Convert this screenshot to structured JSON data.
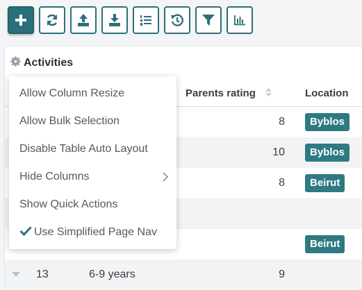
{
  "toolbar": {
    "buttons": [
      {
        "name": "add-button",
        "icon": "plus-icon"
      },
      {
        "name": "refresh-button",
        "icon": "refresh-icon"
      },
      {
        "name": "export-button",
        "icon": "upload-icon"
      },
      {
        "name": "import-button",
        "icon": "download-icon"
      },
      {
        "name": "columns-list-button",
        "icon": "numbered-list-icon"
      },
      {
        "name": "history-button",
        "icon": "history-icon"
      },
      {
        "name": "filter-button",
        "icon": "filter-icon"
      },
      {
        "name": "chart-button",
        "icon": "bar-chart-icon"
      }
    ]
  },
  "panel": {
    "title": "Activities",
    "icon": "gear-icon"
  },
  "table": {
    "columns": [
      "Parents rating",
      "Location"
    ],
    "rows": [
      {
        "rating": "8",
        "location": "Byblos"
      },
      {
        "rating": "10",
        "location": "Byblos"
      },
      {
        "rating": "8",
        "location": "Beirut"
      },
      {
        "rating": "",
        "location": ""
      },
      {
        "rating": "",
        "location": "Beirut"
      },
      {
        "id": "13",
        "age": "6-9 years",
        "rating": "9",
        "location": ""
      }
    ]
  },
  "menu": {
    "items": [
      {
        "label": "Allow Column Resize"
      },
      {
        "label": "Allow Bulk Selection"
      },
      {
        "label": "Disable Table Auto Layout"
      },
      {
        "label": "Hide Columns",
        "submenu": true
      },
      {
        "label": "Show Quick Actions"
      },
      {
        "label": "Use Simplified Page Nav",
        "checked": true
      }
    ]
  },
  "colors": {
    "accent": "#2b6f7a",
    "badge": "#2f7a82"
  }
}
